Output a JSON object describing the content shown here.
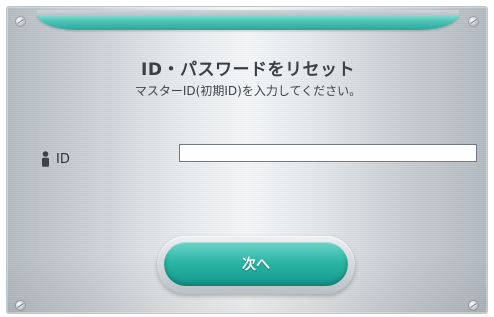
{
  "dialog": {
    "title": "ID・パスワードをリセット",
    "subtitle": "マスターID(初期ID)を入力してください。"
  },
  "form": {
    "id_label": "ID",
    "id_value": "",
    "id_icon": "person-icon"
  },
  "buttons": {
    "next_label": "次へ"
  },
  "colors": {
    "accent": "#2ab5a5",
    "accent_dark": "#14978a",
    "text": "#3a3f44"
  }
}
